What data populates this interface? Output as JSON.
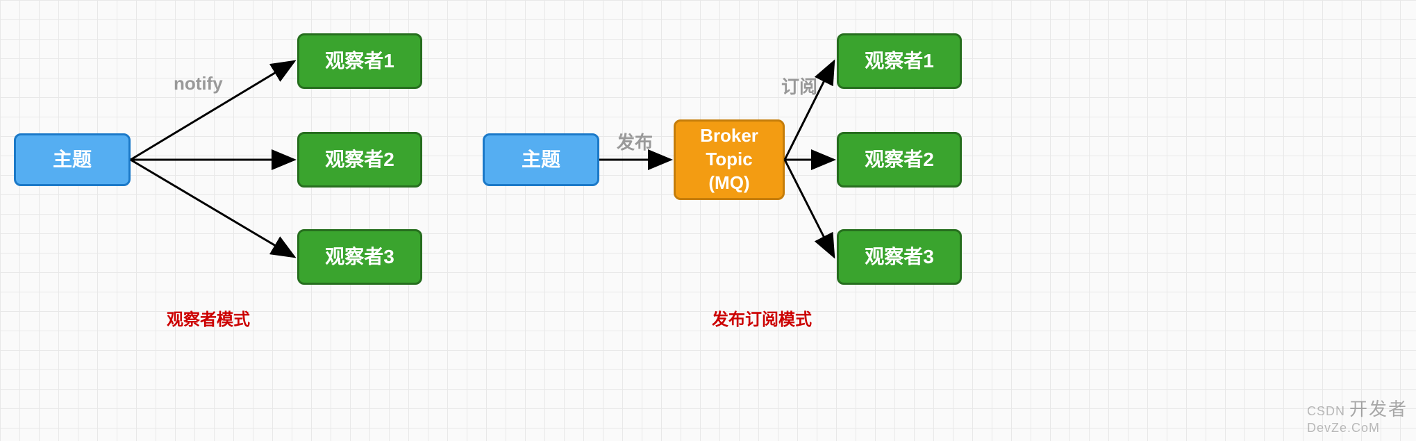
{
  "left": {
    "subject": "主题",
    "observers": [
      "观察者1",
      "观察者2",
      "观察者3"
    ],
    "edge_label": "notify",
    "caption": "观察者模式"
  },
  "right": {
    "subject": "主题",
    "broker": "Broker\nTopic\n(MQ)",
    "observers": [
      "观察者1",
      "观察者2",
      "观察者3"
    ],
    "publish_label": "发布",
    "subscribe_label": "订阅",
    "caption": "发布订阅模式"
  },
  "watermark_small": "CSDN",
  "watermark_big": "开发者",
  "watermark_tail": "DevZe.CoM",
  "colors": {
    "blue_fill": "#55aef2",
    "blue_border": "#1b79c8",
    "green_fill": "#3aa42e",
    "green_border": "#266e1e",
    "orange_fill": "#f39c12",
    "orange_border": "#c57d0a",
    "label_gray": "#999999",
    "caption_red": "#cc0000"
  }
}
